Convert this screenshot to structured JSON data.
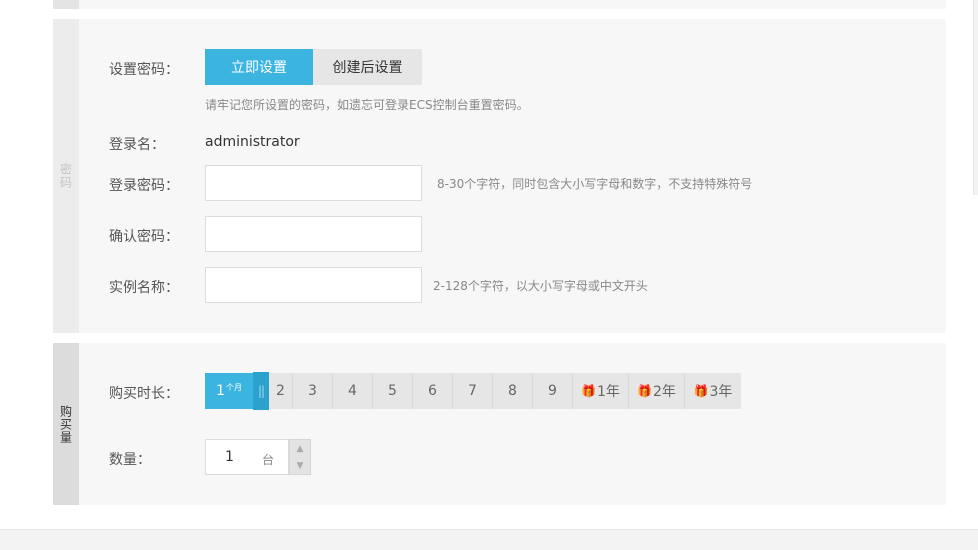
{
  "password": {
    "section_label": "密码",
    "set_password_label": "设置密码：",
    "set_now_label": "立即设置",
    "set_later_label": "创建后设置",
    "reminder": "请牢记您所设置的密码，如遗忘可登录ECS控制台重置密码。",
    "login_name_label": "登录名：",
    "login_name_value": "administrator",
    "login_password_label": "登录密码：",
    "login_password_value": "",
    "password_hint": "8-30个字符，同时包含大小写字母和数字，不支持特殊符号",
    "confirm_password_label": "确认密码：",
    "confirm_password_value": "",
    "instance_name_label": "实例名称：",
    "instance_name_value": "",
    "instance_name_hint": "2-128个字符，以大小写字母或中文开头"
  },
  "purchase": {
    "section_label": "购买量",
    "duration_label": "购买时长：",
    "selected_duration": "1",
    "selected_unit": "个月",
    "handle_glyph": "||",
    "month_options": [
      "2",
      "3",
      "4",
      "5",
      "6",
      "7",
      "8",
      "9"
    ],
    "year_options": [
      "1年",
      "2年",
      "3年"
    ],
    "gift_icon": "gift-icon",
    "quantity_label": "数量：",
    "quantity_value": "1",
    "quantity_unit": "台"
  },
  "colors": {
    "accent": "#3cb4e0",
    "accent_dark": "#2aa2cd",
    "gift": "#f07f3c"
  }
}
